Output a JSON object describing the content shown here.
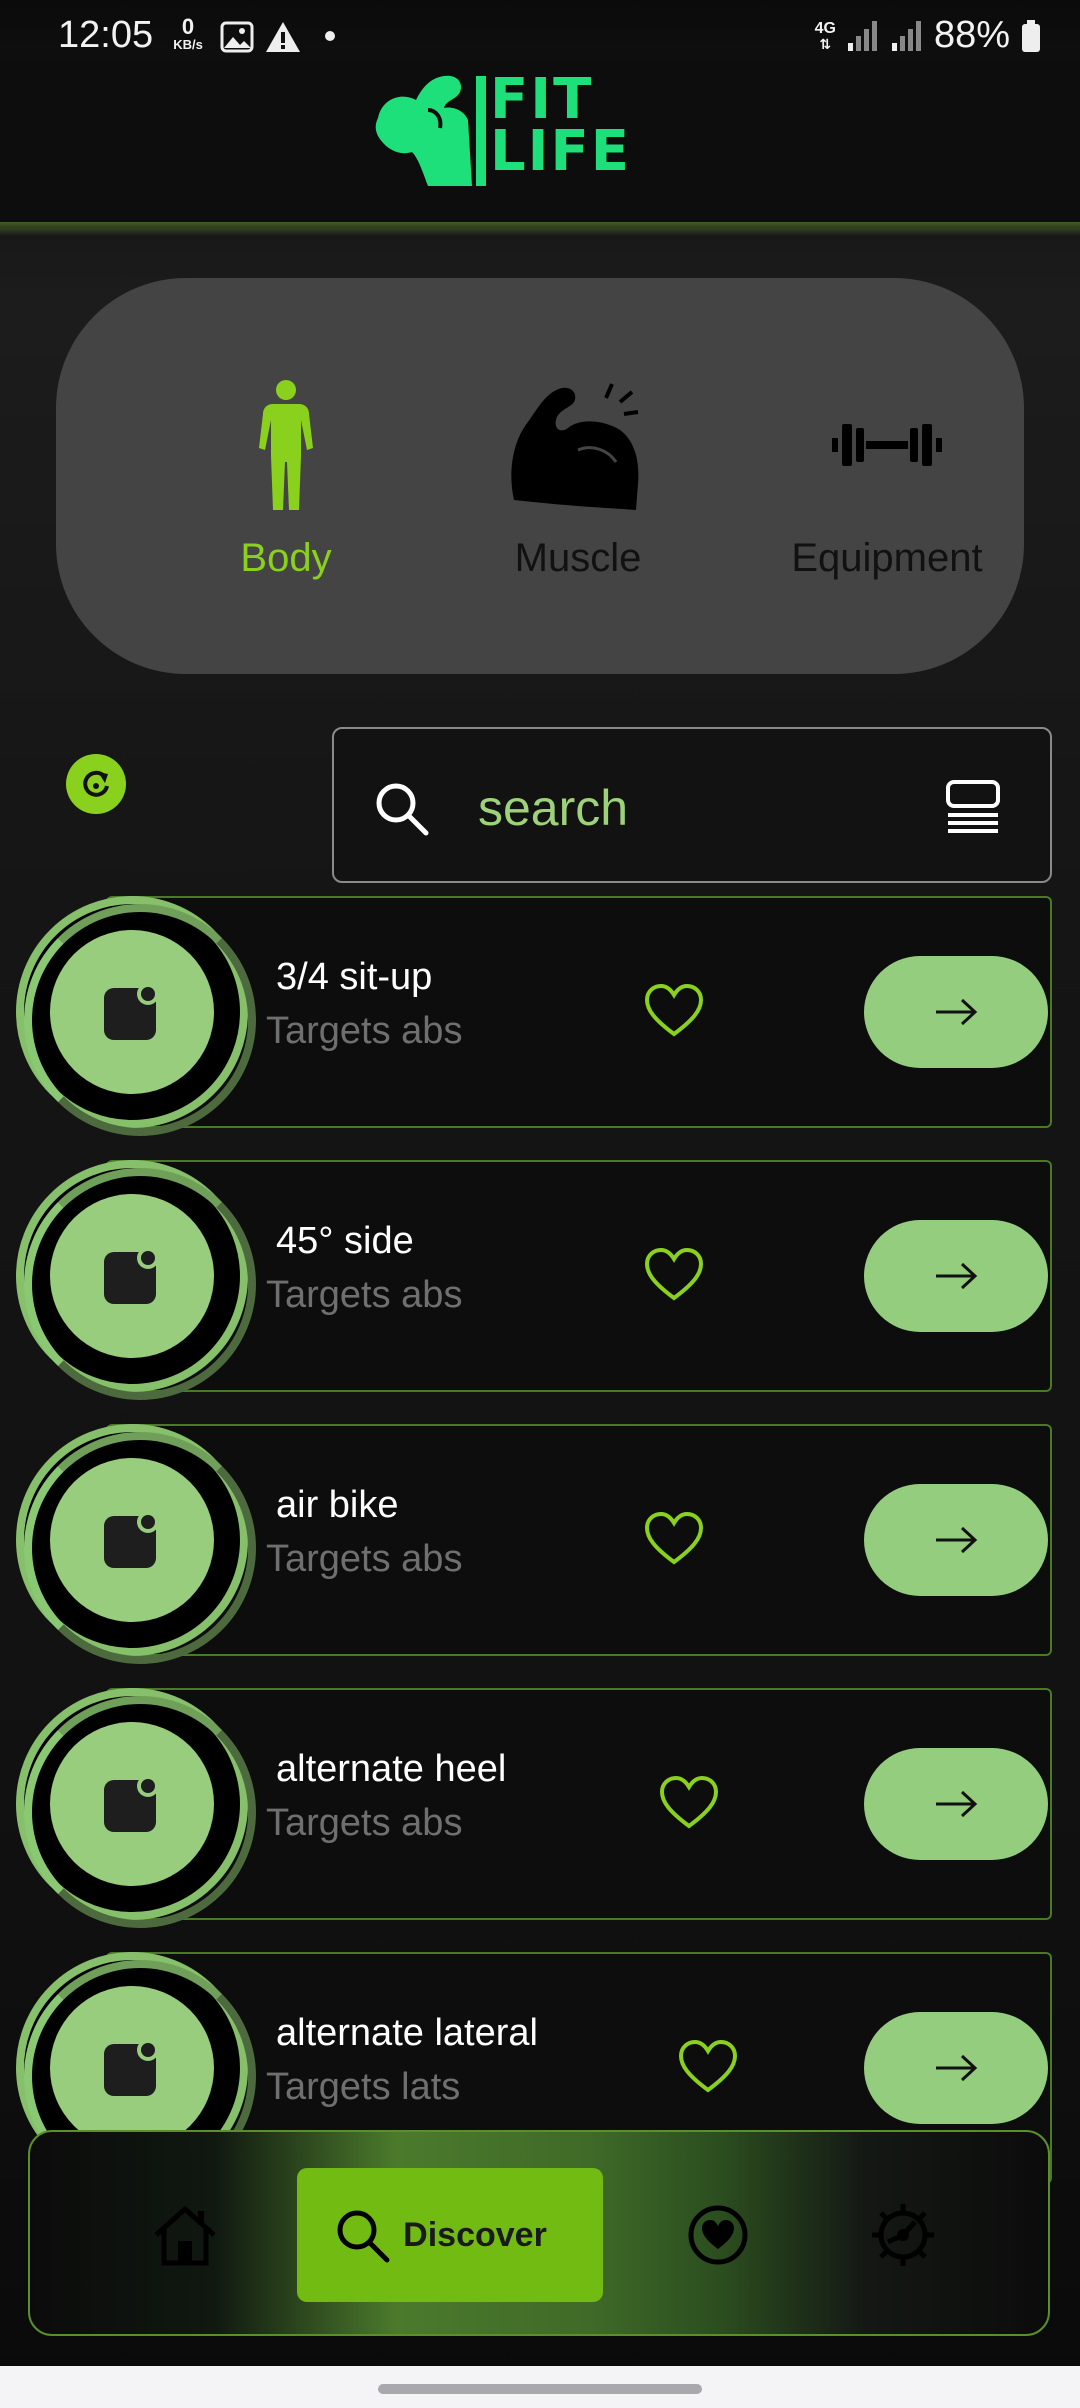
{
  "status_bar": {
    "time": "12:05",
    "data_rate_value": "0",
    "data_rate_unit": "KB/s",
    "network_label": "4G",
    "battery": "88%"
  },
  "app": {
    "logo_line1": "FIT",
    "logo_line2": "LIFE",
    "brand_color": "#1ee07a",
    "accent_color": "#8ad11e"
  },
  "categories": [
    {
      "label": "Body",
      "icon": "body-figure-icon",
      "selected": true
    },
    {
      "label": "Muscle",
      "icon": "flexed-bicep-icon",
      "selected": false
    },
    {
      "label": "Equipment",
      "icon": "dumbbell-icon",
      "selected": false
    }
  ],
  "search": {
    "placeholder": "search"
  },
  "exercises": [
    {
      "name": "3/4 sit-up",
      "target": "Targets abs"
    },
    {
      "name": "45° side",
      "target": "Targets abs"
    },
    {
      "name": "air bike",
      "target": "Targets abs"
    },
    {
      "name": "alternate heel",
      "target": "Targets abs"
    },
    {
      "name": "alternate lateral",
      "target": "Targets lats"
    }
  ],
  "bottom_nav": {
    "items": [
      {
        "icon": "home-icon",
        "label": ""
      },
      {
        "icon": "search-icon",
        "label": "Discover",
        "active": true
      },
      {
        "icon": "heart-circle-icon",
        "label": ""
      },
      {
        "icon": "settings-gear-icon",
        "label": ""
      }
    ]
  }
}
